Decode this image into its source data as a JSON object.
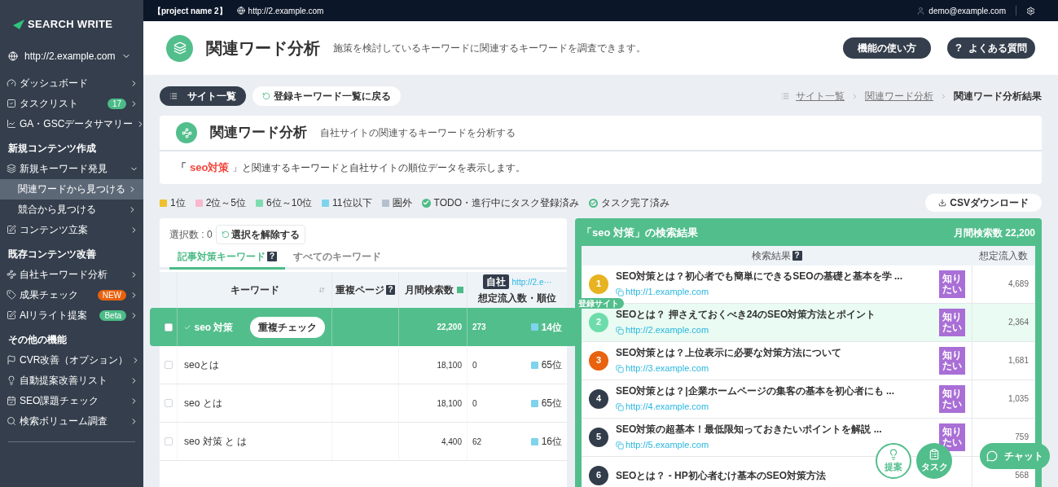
{
  "sidebar": {
    "logo": "SEARCH WRITE",
    "site": "http://2.example.com",
    "groups": [
      {
        "items": [
          {
            "label": "ダッシュボード",
            "selected": false
          },
          {
            "label": "タスクリスト",
            "selected": false,
            "badge": {
              "label": "17",
              "color": "#4cbb87"
            }
          },
          {
            "label": "GA・GSCデータサマリー",
            "selected": false
          }
        ]
      },
      {
        "heading": "新規コンテンツ作成",
        "items": [
          {
            "label": "新規キーワード発見",
            "selected": false,
            "expanded": true,
            "children": [
              {
                "label": "関連ワードから見つける",
                "selected": true
              },
              {
                "label": "競合から見つける",
                "selected": false
              }
            ]
          },
          {
            "label": "コンテンツ立案",
            "selected": false
          }
        ]
      },
      {
        "heading": "既存コンテンツ改善",
        "items": [
          {
            "label": "自社キーワード分析",
            "selected": false
          },
          {
            "label": "成果チェック",
            "selected": false,
            "badge": {
              "label": "NEW",
              "color": "#e8620f"
            }
          },
          {
            "label": "AIリライト提案",
            "selected": false,
            "badge": {
              "label": "Beta",
              "color": "#4cbb87"
            }
          }
        ]
      },
      {
        "heading": "その他の機能",
        "items": [
          {
            "label": "CVR改善（オプション）",
            "selected": false
          },
          {
            "label": "自動提案改善リスト",
            "selected": false
          },
          {
            "label": "SEO課題チェック",
            "selected": false
          },
          {
            "label": "検索ボリューム調査",
            "selected": false
          }
        ]
      }
    ]
  },
  "topbar": {
    "project": "【project name 2】",
    "url": "http://2.example.com",
    "user": "demo@example.com"
  },
  "header": {
    "title": "関連ワード分析",
    "description": "施策を検討しているキーワードに関連するキーワードを調査できます。",
    "buttons": [
      {
        "label": "機能の使い方"
      },
      {
        "label": "よくある質問",
        "mark": "?"
      }
    ]
  },
  "toolbar": {
    "site_list": "サイト一覧",
    "back": "登録キーワード一覧に戻る",
    "breadcrumb": [
      {
        "label": "サイト一覧",
        "current": false
      },
      {
        "label": "関連ワード分析",
        "current": false
      },
      {
        "label": "関連ワード分析結果",
        "current": true
      }
    ]
  },
  "card": {
    "title": "関連ワード分析",
    "subtitle": "自社サイトの関連するキーワードを分析する",
    "open_quote": "「",
    "keyword": "seo対策",
    "notice": "」と関連するキーワードと自社サイトの順位データを表示します。"
  },
  "legend": [
    {
      "kind": "swatch",
      "color": "#f0c030",
      "label": "1位"
    },
    {
      "kind": "swatch",
      "color": "#f9b8cc",
      "label": "2位～5位"
    },
    {
      "kind": "swatch",
      "color": "#7fdcb0",
      "label": "6位～10位"
    },
    {
      "kind": "swatch",
      "color": "#7fd3ec",
      "label": "11位以下"
    },
    {
      "kind": "swatch",
      "color": "#b4c0cc",
      "label": "圏外"
    },
    {
      "kind": "solid",
      "color": "#4cbb87",
      "label": "TODO・進行中にタスク登録済み"
    },
    {
      "kind": "outline",
      "color": "#4cbb87",
      "label": "タスク完了済み"
    }
  ],
  "csv_button": "CSVダウンロード",
  "keywords": {
    "selection": "選択数 : 0",
    "clear": "選択を解除する",
    "tabs": [
      {
        "label": "記事対策キーワード",
        "selected": true,
        "help": "?"
      },
      {
        "label": "すべてのキーワード",
        "selected": false
      }
    ],
    "columns": {
      "keyword": "キーワード",
      "duplicate": "重複ページ",
      "duplicate_help": "?",
      "volume": "月間検索数",
      "own_badge": "自社",
      "own_url": "http://2.e···",
      "own_sub": "想定流入数・順位"
    },
    "rows": [
      {
        "checked": false,
        "highlighted": true,
        "target": true,
        "keyword": "seo 対策",
        "action": "重複チェック",
        "volume": "22,200",
        "traffic": "273",
        "rank": "14位",
        "color": "#7fd3ec"
      },
      {
        "checked": false,
        "highlighted": false,
        "target": false,
        "keyword": "seoとは",
        "volume": "18,100",
        "traffic": "0",
        "rank": "65位",
        "color": "#7fd3ec"
      },
      {
        "checked": false,
        "highlighted": false,
        "target": false,
        "keyword": "seo とは",
        "volume": "18,100",
        "traffic": "0",
        "rank": "65位",
        "color": "#7fd3ec"
      },
      {
        "checked": false,
        "highlighted": false,
        "target": false,
        "keyword": "seo 対策 と は",
        "volume": "4,400",
        "traffic": "62",
        "rank": "16位",
        "color": "#7fd3ec"
      }
    ]
  },
  "serp": {
    "title": "「seo 対策」の検索結果",
    "volume": "月間検索数 22,200",
    "col_result": "検索結果",
    "col_help": "?",
    "col_traffic": "想定流入数",
    "own_site_label": "登録サイト",
    "results": [
      {
        "rank": "1",
        "color": "#e8b321",
        "own_site": false,
        "title": "SEO対策とは？初心者でも簡単にできるSEOの基礎と基本を学 ...",
        "url": "http://1.example.com",
        "intent": "知りたい",
        "traffic": "4,689"
      },
      {
        "rank": "2",
        "color": "#6ddcaa",
        "own_site": true,
        "title": "SEOとは？ 押さえておくべき24のSEO対策方法とポイント",
        "url": "http://2.example.com",
        "intent": "知りたい",
        "traffic": "2,364"
      },
      {
        "rank": "3",
        "color": "#e8620f",
        "own_site": false,
        "title": "SEO対策とは？上位表示に必要な対策方法について",
        "url": "http://3.example.com",
        "intent": "知りたい",
        "traffic": "1,681"
      },
      {
        "rank": "4",
        "color": "#323c4a",
        "own_site": false,
        "title": "SEO対策とは？|企業ホームページの集客の基本を初心者にも ...",
        "url": "http://4.example.com",
        "intent": "知りたい",
        "traffic": "1,035"
      },
      {
        "rank": "5",
        "color": "#323c4a",
        "own_site": false,
        "title": "SEO対策の超基本！最低限知っておきたいポイントを解説 ...",
        "url": "http://5.example.com",
        "intent": "知りたい",
        "traffic": "759"
      },
      {
        "rank": "6",
        "color": "#323c4a",
        "own_site": false,
        "title": "SEOとは？ - HP初心者むけ基本のSEO対策方法",
        "traffic": "568"
      }
    ]
  },
  "floating": {
    "suggest": "提案",
    "task": "タスク",
    "chat": "チャット"
  }
}
